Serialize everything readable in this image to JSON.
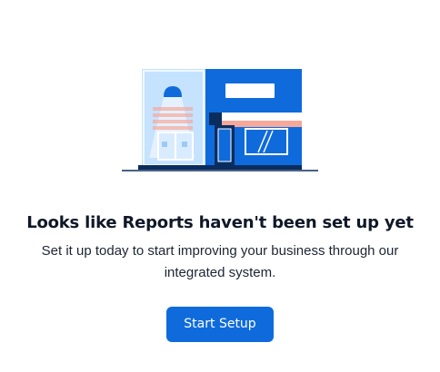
{
  "empty_state": {
    "title": "Looks like Reports haven't been set up yet",
    "description": "Set it up today to start improving your business through our integrated system.",
    "button_label": "Start Setup"
  },
  "illustration": {
    "icon": "storefront-illustration",
    "colors": {
      "blue": "#0f6bdc",
      "light_blue": "#b8dcff",
      "navy": "#0b2d5e",
      "awning": "#f6a89a"
    }
  }
}
